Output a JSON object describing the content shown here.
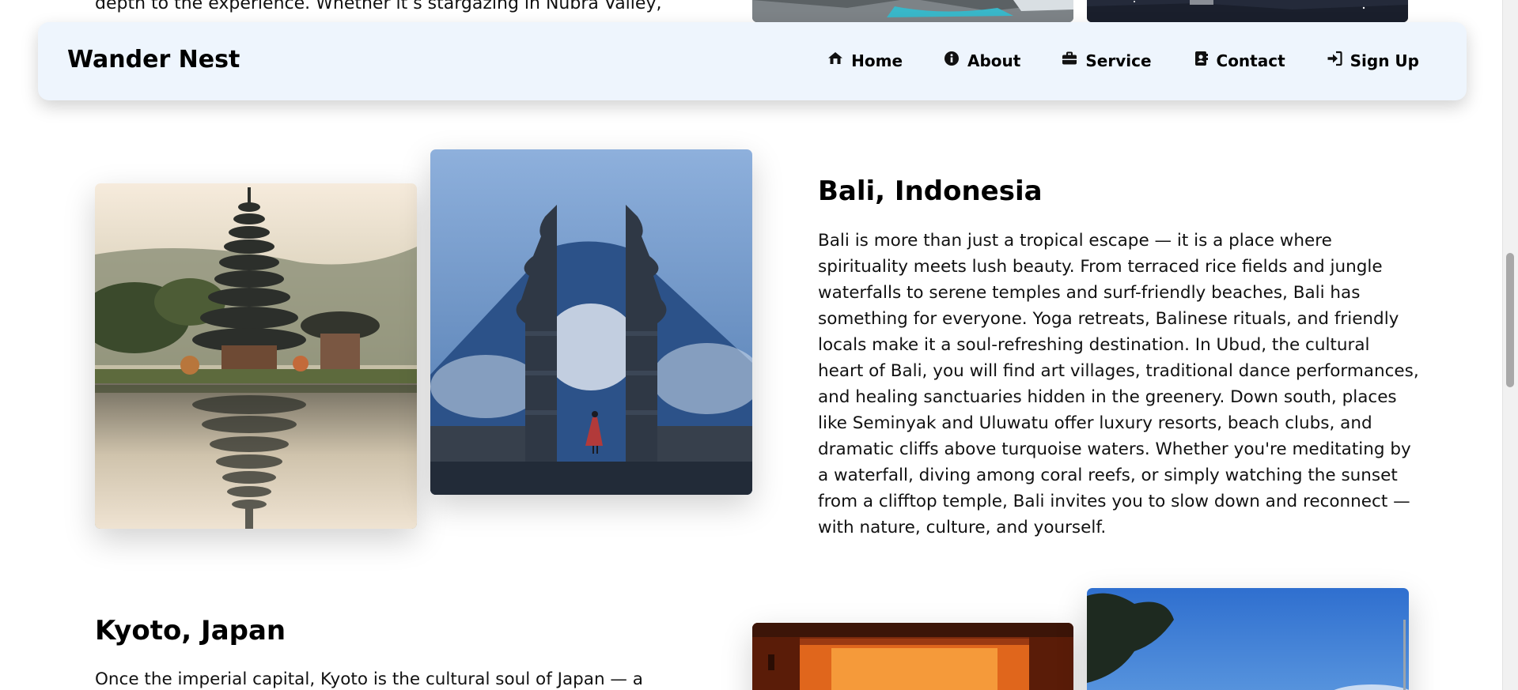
{
  "nav": {
    "brand": "Wander Nest",
    "links": [
      {
        "label": "Home",
        "icon": "home-icon"
      },
      {
        "label": "About",
        "icon": "info-icon"
      },
      {
        "label": "Service",
        "icon": "briefcase-icon"
      },
      {
        "label": "Contact",
        "icon": "contact-card-icon"
      },
      {
        "label": "Sign Up",
        "icon": "sign-in-icon"
      }
    ]
  },
  "prev_section": {
    "tail_text": "depth to the experience. Whether it’s stargazing in Nubra Valley,"
  },
  "bali": {
    "title": "Bali, Indonesia",
    "body": "Bali is more than just a tropical escape — it is a place where spirituality meets lush beauty. From terraced rice fields and jungle waterfalls to serene temples and surf-friendly beaches, Bali has something for everyone. Yoga retreats, Balinese rituals, and friendly locals make it a soul-refreshing destination. In Ubud, the cultural heart of Bali, you will find art villages, traditional dance performances, and healing sanctuaries hidden in the greenery. Down south, places like Seminyak and Uluwatu offer luxury resorts, beach clubs, and dramatic cliffs above turquoise waters. Whether you're meditating by a waterfall, diving among coral reefs, or simply watching the sunset from a clifftop temple, Bali invites you to slow down and reconnect — with nature, culture, and yourself."
  },
  "kyoto": {
    "title": "Kyoto, Japan",
    "body": "Once the imperial capital, Kyoto is the cultural soul of Japan — a"
  }
}
